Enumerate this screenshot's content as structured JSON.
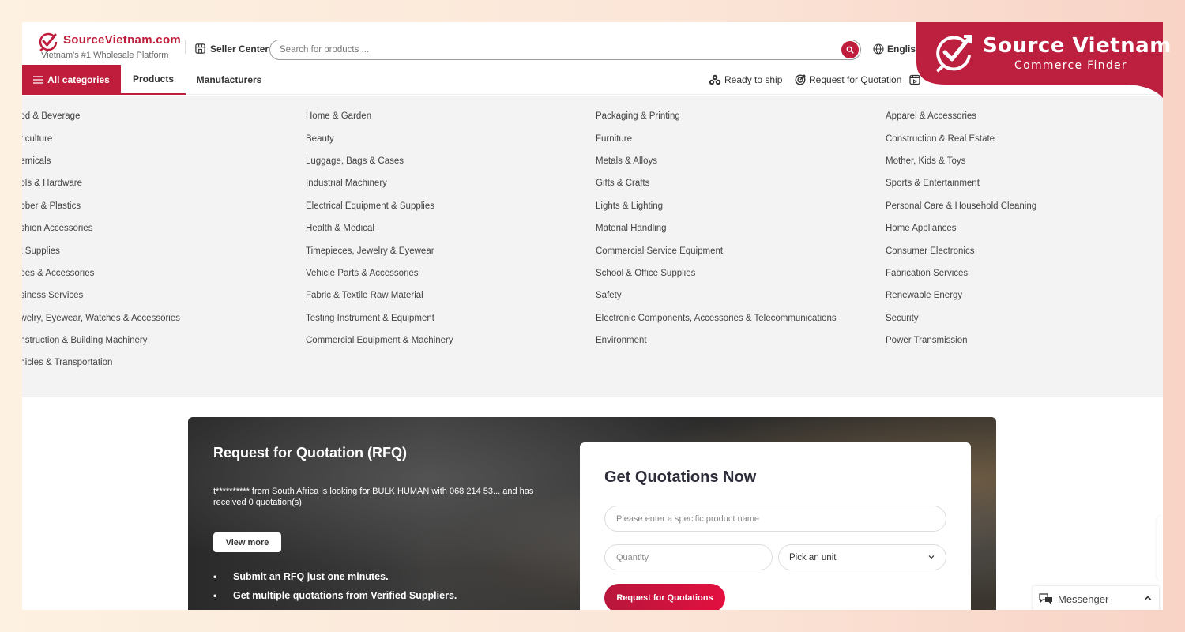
{
  "header": {
    "logo_title": "SourceVietnam.com",
    "logo_subtitle": "Vietnam's #1 Wholesale Platform",
    "seller_center": "Seller Center",
    "search_placeholder": "Search for products ...",
    "language": "English"
  },
  "nav": {
    "all_categories": "All categories",
    "tabs": [
      {
        "label": "Products",
        "active": true
      },
      {
        "label": "Manufacturers",
        "active": false
      }
    ],
    "right_links": [
      {
        "label": "Ready to ship",
        "icon": "boxes-icon"
      },
      {
        "label": "Request for Quotation",
        "icon": "target-icon"
      },
      {
        "label": "",
        "icon": "video-icon"
      }
    ]
  },
  "categories": {
    "col1": [
      "ood & Beverage",
      "griculture",
      "hemicals",
      "ools & Hardware",
      "ubber & Plastics",
      "ashion Accessories",
      "et Supplies",
      "hoes & Accessories",
      "usiness Services",
      "ewelry, Eyewear, Watches & Accessories",
      "onstruction & Building Machinery",
      "ehicles & Transportation"
    ],
    "col2": [
      "Home & Garden",
      "Beauty",
      "Luggage, Bags & Cases",
      "Industrial Machinery",
      "Electrical Equipment & Supplies",
      "Health & Medical",
      "Timepieces, Jewelry & Eyewear",
      "Vehicle Parts & Accessories",
      "Fabric & Textile Raw Material",
      "Testing Instrument & Equipment",
      "Commercial Equipment & Machinery"
    ],
    "col3": [
      "Packaging & Printing",
      "Furniture",
      "Metals & Alloys",
      "Gifts & Crafts",
      "Lights & Lighting",
      "Material Handling",
      "Commercial Service Equipment",
      "School & Office Supplies",
      "Safety",
      "Electronic Components, Accessories & Telecommunications",
      "Environment"
    ],
    "col4": [
      "Apparel & Accessories",
      "Construction & Real Estate",
      "Mother, Kids & Toys",
      "Sports & Entertainment",
      "Personal Care & Household Cleaning",
      "Home Appliances",
      "Consumer Electronics",
      "Fabrication Services",
      "Renewable Energy",
      "Security",
      "Power Transmission"
    ]
  },
  "rfq": {
    "title": "Request for Quotation (RFQ)",
    "ticker": "t********** from South Africa is looking for BULK HUMAN with 068 214 53... and has received 0 quotation(s)",
    "view_more": "View more",
    "bullets": [
      "Submit an RFQ just one minutes.",
      "Get multiple quotations from Verified Suppliers."
    ]
  },
  "quote_form": {
    "title": "Get Quotations Now",
    "product_placeholder": "Please enter a specific product name",
    "quantity_placeholder": "Quantity",
    "unit_selected": "Pick an unit",
    "submit": "Request for Quotations"
  },
  "messenger": {
    "label": "Messenger"
  },
  "brand_overlay": {
    "title": "Source Vietnam",
    "subtitle": "Commerce Finder"
  },
  "colors": {
    "brand_red": "#c01c3c",
    "menu_bg": "#f3f3f3"
  }
}
